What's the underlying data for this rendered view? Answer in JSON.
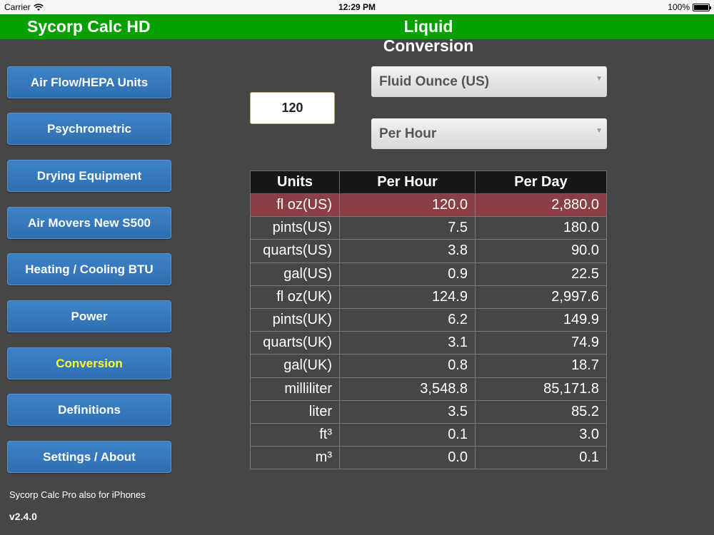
{
  "status": {
    "carrier": "Carrier",
    "time": "12:29 PM",
    "battery": "100%"
  },
  "header": {
    "app_title": "Sycorp Calc HD",
    "page_title": "Liquid Conversion"
  },
  "nav": [
    {
      "label": "Air Flow/HEPA Units",
      "active": false
    },
    {
      "label": "Psychrometric",
      "active": false
    },
    {
      "label": "Drying Equipment",
      "active": false
    },
    {
      "label": "Air Movers New S500",
      "active": false
    },
    {
      "label": "Heating / Cooling BTU",
      "active": false
    },
    {
      "label": "Power",
      "active": false
    },
    {
      "label": "Conversion",
      "active": true
    },
    {
      "label": "Definitions",
      "active": false
    },
    {
      "label": "Settings / About",
      "active": false
    }
  ],
  "footer": {
    "promo": "Sycorp Calc Pro also for iPhones",
    "version": "v2.4.0"
  },
  "input": {
    "value": "120"
  },
  "unit_select": {
    "selected": "Fluid Ounce (US)"
  },
  "rate_select": {
    "selected": "Per Hour"
  },
  "table": {
    "headers": [
      "Units",
      "Per Hour",
      "Per Day"
    ],
    "rows": [
      {
        "unit": "fl oz(US)",
        "per_hour": "120.0",
        "per_day": "2,880.0",
        "selected": true
      },
      {
        "unit": "pints(US)",
        "per_hour": "7.5",
        "per_day": "180.0"
      },
      {
        "unit": "quarts(US)",
        "per_hour": "3.8",
        "per_day": "90.0"
      },
      {
        "unit": "gal(US)",
        "per_hour": "0.9",
        "per_day": "22.5"
      },
      {
        "unit": "fl oz(UK)",
        "per_hour": "124.9",
        "per_day": "2,997.6"
      },
      {
        "unit": "pints(UK)",
        "per_hour": "6.2",
        "per_day": "149.9"
      },
      {
        "unit": "quarts(UK)",
        "per_hour": "3.1",
        "per_day": "74.9"
      },
      {
        "unit": "gal(UK)",
        "per_hour": "0.8",
        "per_day": "18.7"
      },
      {
        "unit": "milliliter",
        "per_hour": "3,548.8",
        "per_day": "85,171.8"
      },
      {
        "unit": "liter",
        "per_hour": "3.5",
        "per_day": "85.2"
      },
      {
        "unit": "ft³",
        "per_hour": "0.1",
        "per_day": "3.0"
      },
      {
        "unit": "m³",
        "per_hour": "0.0",
        "per_day": "0.1"
      }
    ]
  },
  "colors": {
    "header_green": "#06a000",
    "button_blue": "#3576bd",
    "active_text": "#ffff33",
    "selected_row": "#8b3f44",
    "background": "#464646"
  },
  "icons": {
    "wifi": "wifi-icon",
    "battery": "battery-icon",
    "chevron": "chevron-down-icon"
  }
}
